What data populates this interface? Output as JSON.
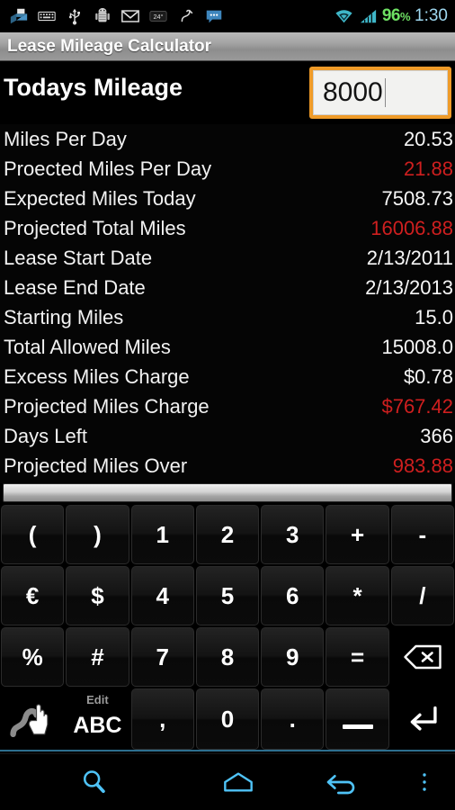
{
  "status_bar": {
    "icons": [
      {
        "name": "downloads-icon"
      },
      {
        "name": "keyboard-icon"
      },
      {
        "name": "usb-icon"
      },
      {
        "name": "android-robot-icon"
      },
      {
        "name": "gmail-icon"
      },
      {
        "name": "weather-icon",
        "label": "24°"
      },
      {
        "name": "bluetooth-connected-icon"
      },
      {
        "name": "sms-message-icon"
      }
    ],
    "wifi_icon": "wifi-icon",
    "signal_icon": "cellular-signal-icon",
    "battery_percent": "96",
    "battery_unit": "%",
    "clock": "1:30",
    "battery_color": "#6ee063",
    "clock_color": "#9fd8f0",
    "accent_teal": "#3fb6c8"
  },
  "title_bar": {
    "title": "Lease Mileage Calculator"
  },
  "header": {
    "label": "Todays Mileage",
    "input_value": "8000",
    "input_placeholder": "",
    "input_border_color": "#ef9b28"
  },
  "colors": {
    "value_white": "#f7f7f7",
    "value_red": "#cf1f1f"
  },
  "rows": [
    {
      "label": "Miles Per Day",
      "value": "20.53",
      "style": "white"
    },
    {
      "label": "Proected Miles Per Day",
      "value": "21.88",
      "style": "red"
    },
    {
      "label": "Expected Miles Today",
      "value": "7508.73",
      "style": "white"
    },
    {
      "label": "Projected Total Miles",
      "value": "16006.88",
      "style": "red"
    },
    {
      "label": "Lease Start Date",
      "value": "2/13/2011",
      "style": "white"
    },
    {
      "label": "Lease End Date",
      "value": "2/13/2013",
      "style": "white"
    },
    {
      "label": "Starting Miles",
      "value": "15.0",
      "style": "white"
    },
    {
      "label": "Total Allowed Miles",
      "value": "15008.0",
      "style": "white"
    },
    {
      "label": "Excess Miles Charge",
      "value": "$0.78",
      "style": "white"
    },
    {
      "label": "Projected Miles Charge",
      "value": "$767.42",
      "style": "red"
    },
    {
      "label": "Days Left",
      "value": "366",
      "style": "white"
    },
    {
      "label": "Projected Miles Over",
      "value": "983.88",
      "style": "red"
    }
  ],
  "keyboard": {
    "handle_name": "keyboard-resize-handle",
    "rows": [
      [
        {
          "label": "(",
          "name": "key-open-paren"
        },
        {
          "label": ")",
          "name": "key-close-paren"
        },
        {
          "label": "1",
          "name": "key-1"
        },
        {
          "label": "2",
          "name": "key-2"
        },
        {
          "label": "3",
          "name": "key-3"
        },
        {
          "label": "+",
          "name": "key-plus"
        },
        {
          "label": "-",
          "name": "key-minus"
        }
      ],
      [
        {
          "label": "€",
          "name": "key-euro"
        },
        {
          "label": "$",
          "name": "key-dollar"
        },
        {
          "label": "4",
          "name": "key-4"
        },
        {
          "label": "5",
          "name": "key-5"
        },
        {
          "label": "6",
          "name": "key-6"
        },
        {
          "label": "*",
          "name": "key-asterisk"
        },
        {
          "label": "/",
          "name": "key-slash"
        }
      ],
      [
        {
          "label": "%",
          "name": "key-percent"
        },
        {
          "label": "#",
          "name": "key-hash"
        },
        {
          "label": "7",
          "name": "key-7"
        },
        {
          "label": "8",
          "name": "key-8"
        },
        {
          "label": "9",
          "name": "key-9"
        },
        {
          "label": "=",
          "name": "key-equals"
        },
        {
          "label": "",
          "name": "key-backspace",
          "icon": "backspace-icon"
        }
      ],
      [
        {
          "label": "",
          "name": "key-gesture-input",
          "icon": "swipe-hand-icon"
        },
        {
          "label": "ABC",
          "sub": "Edit",
          "name": "key-abc-edit"
        },
        {
          "label": ",",
          "name": "key-comma"
        },
        {
          "label": "0",
          "name": "key-0"
        },
        {
          "label": ".",
          "name": "key-period"
        },
        {
          "label": "",
          "name": "key-space",
          "icon": "space-icon"
        },
        {
          "label": "",
          "name": "key-enter",
          "icon": "enter-icon"
        }
      ]
    ]
  },
  "nav_bar": {
    "color": "#4fc3f7",
    "items": [
      {
        "name": "nav-search-button",
        "icon": "search-icon"
      },
      {
        "name": "nav-home-button",
        "icon": "home-icon"
      },
      {
        "name": "nav-back-button",
        "icon": "back-icon"
      },
      {
        "name": "nav-menu-button",
        "icon": "overflow-menu-icon"
      }
    ]
  }
}
